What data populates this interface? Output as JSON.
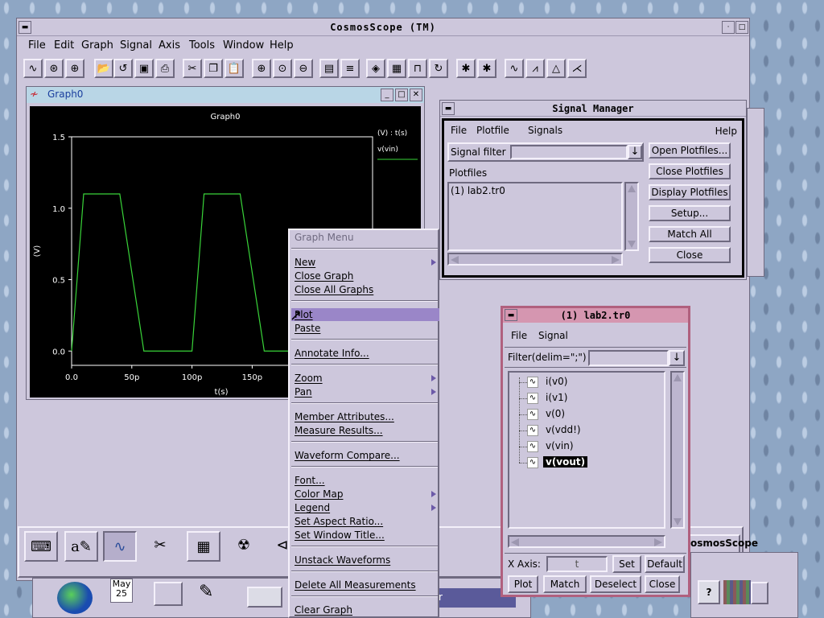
{
  "app": {
    "title": "CosmosScope (TM)",
    "menu": [
      "File",
      "Edit",
      "Graph",
      "Signal",
      "Axis",
      "Tools",
      "Window",
      "Help"
    ]
  },
  "toolbar": {
    "icons": [
      "waveform-icon",
      "crosshair-icon",
      "target-icon",
      "open-folder-icon",
      "undo-icon",
      "save-icon",
      "print-icon",
      "cut-icon",
      "copy-icon",
      "paste-icon",
      "zoom-in-icon",
      "zoom-fit-icon",
      "zoom-out-icon",
      "stack-icon",
      "colors-icon",
      "diamond-icon",
      "grid-icon",
      "step-icon",
      "refresh-icon",
      "bug-icon",
      "bug2-icon",
      "measure1-icon",
      "measure2-icon",
      "measure3-icon",
      "measure4-icon"
    ]
  },
  "graph_window": {
    "title": "Graph0",
    "legend_units": "(V) : t(s)",
    "legend_signal": "v(vin)"
  },
  "chart_data": {
    "type": "line",
    "title": "Graph0",
    "xlabel": "t(s)",
    "ylabel": "(V)",
    "xlim": [
      0,
      250
    ],
    "ylim": [
      -0.1,
      1.5
    ],
    "x_tick_labels": [
      "0.0",
      "50p",
      "100p",
      "150p"
    ],
    "x_tick_values": [
      0,
      50,
      100,
      150
    ],
    "y_tick_labels": [
      "0.0",
      "0.5",
      "1.0",
      "1.5"
    ],
    "y_tick_values": [
      0,
      0.5,
      1.0,
      1.5
    ],
    "series": [
      {
        "name": "v(vin)",
        "color": "#39d439",
        "x": [
          0,
          10,
          40,
          60,
          100,
          110,
          140,
          160,
          200
        ],
        "y": [
          0,
          1.1,
          1.1,
          0,
          0,
          1.1,
          1.1,
          0,
          0
        ]
      }
    ]
  },
  "context_menu": {
    "title": "Graph Menu",
    "items": [
      {
        "label": "New",
        "submenu": true
      },
      {
        "label": "Close Graph"
      },
      {
        "label": "Close All Graphs"
      },
      {
        "sep": true
      },
      {
        "label": "Plot",
        "highlight": true
      },
      {
        "label": "Paste"
      },
      {
        "sep": true
      },
      {
        "label": "Annotate Info..."
      },
      {
        "sep": true
      },
      {
        "label": "Zoom",
        "submenu": true
      },
      {
        "label": "Pan",
        "submenu": true
      },
      {
        "sep": true
      },
      {
        "label": "Member Attributes..."
      },
      {
        "label": "Measure Results..."
      },
      {
        "sep": true
      },
      {
        "label": "Waveform Compare..."
      },
      {
        "sep": true
      },
      {
        "label": "Font..."
      },
      {
        "label": "Color Map",
        "submenu": true
      },
      {
        "label": "Legend",
        "submenu": true
      },
      {
        "label": "Set Aspect Ratio..."
      },
      {
        "label": "Set Window Title..."
      },
      {
        "sep": true
      },
      {
        "label": "Unstack Waveforms"
      },
      {
        "sep": true
      },
      {
        "label": "Delete All Measurements"
      },
      {
        "sep": true
      },
      {
        "label": "Clear Graph"
      }
    ]
  },
  "signal_manager": {
    "title": "Signal Manager",
    "menu": [
      "File",
      "Plotfile",
      "Signals"
    ],
    "help": "Help",
    "filter_label": "Signal filter",
    "filter_value": "",
    "plotfiles_label": "Plotfiles",
    "plotfiles": [
      "(1) lab2.tr0"
    ],
    "buttons": [
      "Open Plotfiles...",
      "Close Plotfiles",
      "Display Plotfiles",
      "Setup...",
      "Match All",
      "Close"
    ]
  },
  "lab2_window": {
    "title": "(1) lab2.tr0",
    "menu": [
      "File",
      "Signal"
    ],
    "filter_label": "Filter(delim=\";\")",
    "filter_value": "",
    "signals": [
      "i(v0)",
      "i(v1)",
      "v(0)",
      "v(vdd!)",
      "v(vin)",
      "v(vout)"
    ],
    "selected": "v(vout)",
    "xaxis_label": "X Axis:",
    "xaxis_value": "t",
    "set": "Set",
    "default": "Default",
    "buttons": [
      "Plot",
      "Match",
      "Deselect",
      "Close"
    ]
  },
  "bottom": {
    "cosmos_label": "osmosScope",
    "date_month": "May",
    "date_day": "25",
    "panel_tab": "r"
  }
}
